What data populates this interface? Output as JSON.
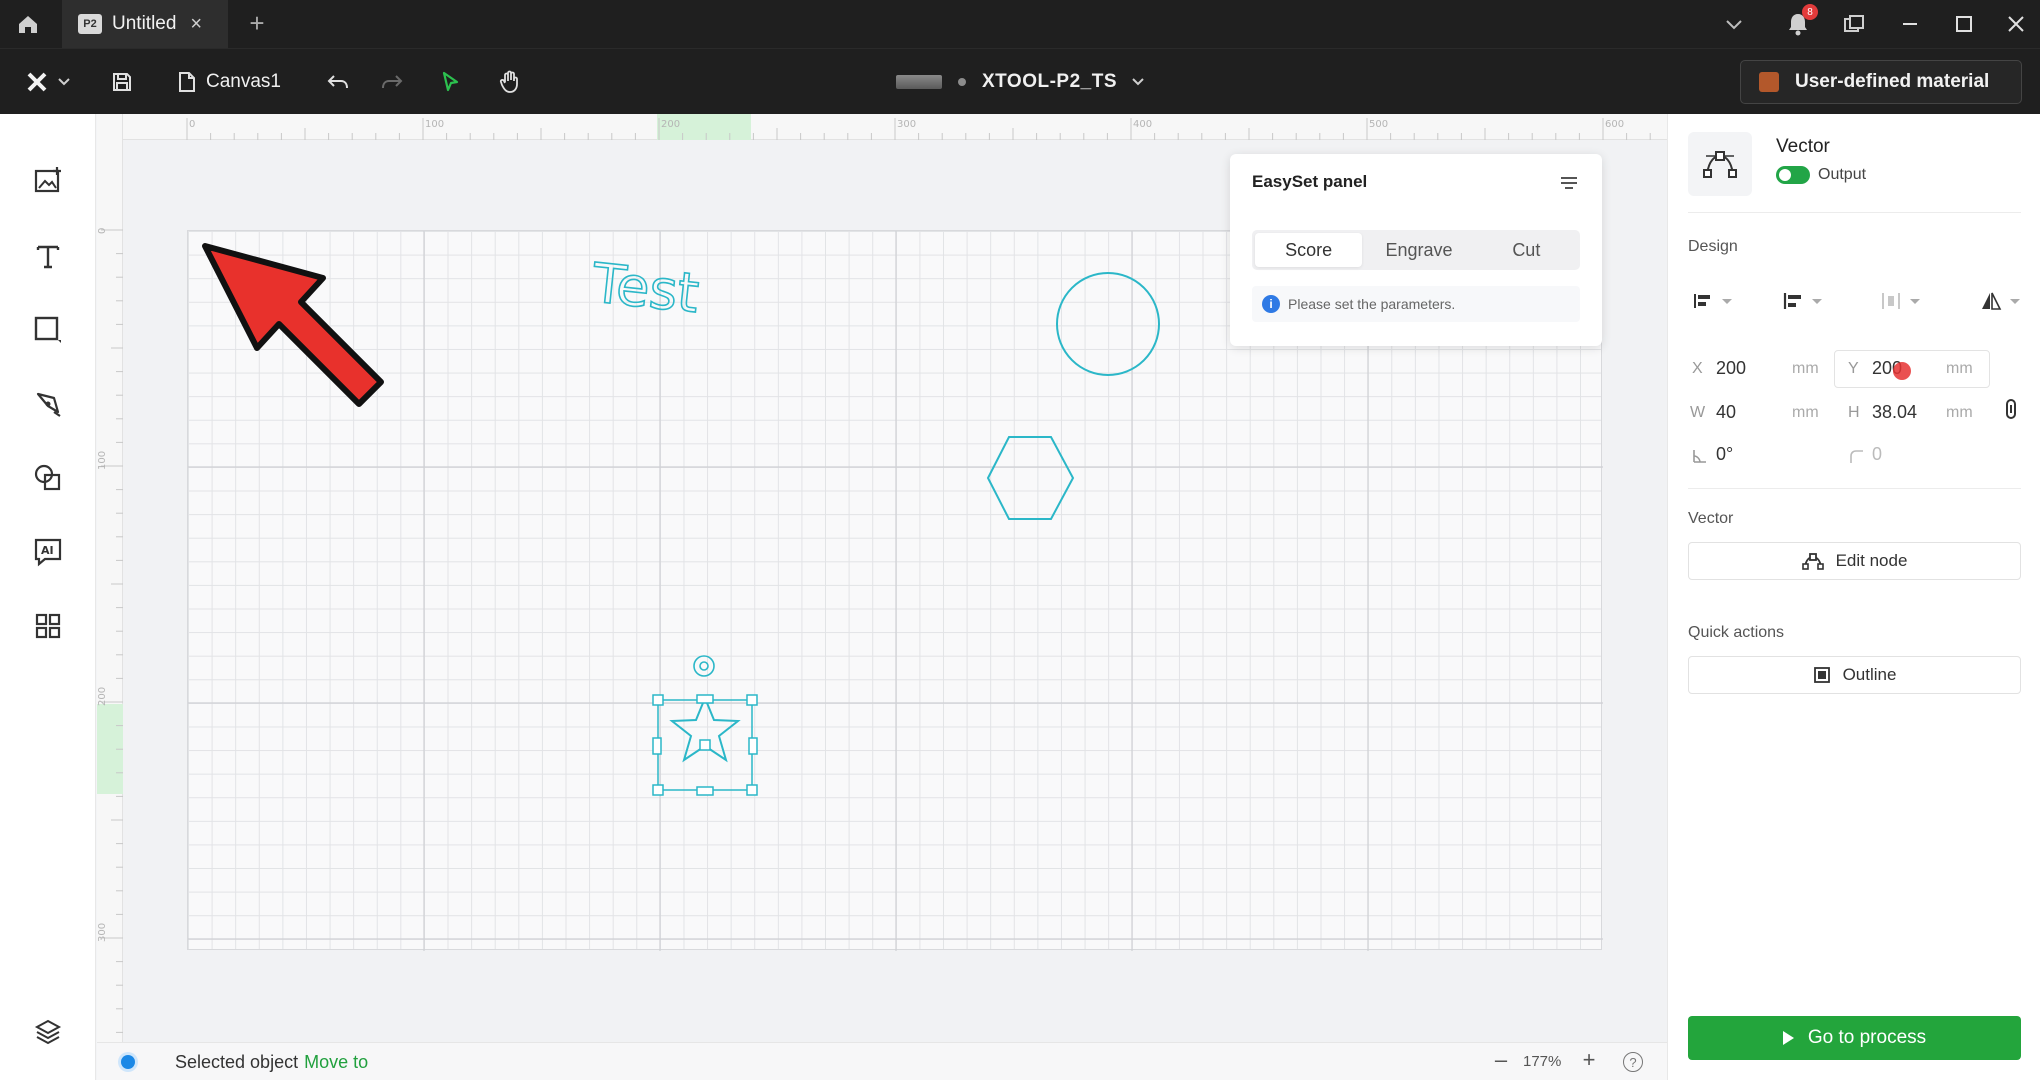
{
  "titlebar": {
    "tab_badge": "P2",
    "tab_title": "Untitled",
    "tab_close": "×",
    "tab_add": "+",
    "notification_count": "8"
  },
  "toolbar": {
    "canvas_name": "Canvas1",
    "device_name": "XTOOL-P2_TS",
    "material_label": "User-defined material"
  },
  "canvas": {
    "text_object": "Test",
    "ruler_top_ticks": [
      "0",
      "100",
      "200",
      "300",
      "400",
      "500",
      "600"
    ],
    "ruler_left_ticks": [
      "0",
      "100",
      "200",
      "300"
    ]
  },
  "easyset": {
    "title": "EasySet panel",
    "tabs": [
      "Score",
      "Engrave",
      "Cut"
    ],
    "active_tab": "Score",
    "info": "Please set the parameters."
  },
  "status": {
    "text": "Selected object",
    "link": "Move to",
    "zoom_minus": "–",
    "zoom": "177%",
    "zoom_plus": "+",
    "help": "?"
  },
  "panel": {
    "object_type": "Vector",
    "output_label": "Output",
    "design_title": "Design",
    "x_label": "X",
    "x_value": "200",
    "x_unit": "mm",
    "y_label": "Y",
    "y_value": "200",
    "y_unit": "mm",
    "w_label": "W",
    "w_value": "40",
    "w_unit": "mm",
    "h_label": "H",
    "h_value": "38.04",
    "h_unit": "mm",
    "rotation_value": "0°",
    "corner_value": "0",
    "vector_title": "Vector",
    "edit_node_label": "Edit node",
    "quick_actions_title": "Quick actions",
    "outline_label": "Outline",
    "process_label": "Go to process"
  },
  "colors": {
    "accent_green": "#23a53c",
    "shape_cyan": "#2bb7c8",
    "arrow_red": "#e8312c"
  }
}
